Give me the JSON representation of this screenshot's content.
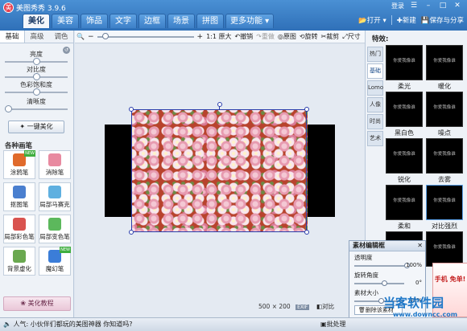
{
  "app": {
    "title": "美图秀秀 3.9.6"
  },
  "top_right": {
    "login": "登录",
    "menu_icon": "menu-icon"
  },
  "tabs": [
    {
      "label": "美化"
    },
    {
      "label": "美容"
    },
    {
      "label": "饰品"
    },
    {
      "label": "文字"
    },
    {
      "label": "边框"
    },
    {
      "label": "场景"
    },
    {
      "label": "拼图"
    },
    {
      "label": "更多功能 ▾"
    }
  ],
  "actions": {
    "open": "打开",
    "new": "新建",
    "save_share": "保存与分享"
  },
  "left_panel": {
    "subtabs": [
      "基础",
      "高级",
      "调色"
    ],
    "sliders": [
      {
        "label": "亮度",
        "value": 0.5
      },
      {
        "label": "对比度",
        "value": 0.5
      },
      {
        "label": "色彩饱和度",
        "value": 0.5
      },
      {
        "label": "清晰度",
        "value": 0.0
      }
    ],
    "one_click": "一键美化",
    "section_title": "各种画笔",
    "brushes": [
      {
        "label": "涂鸦笔",
        "badge": "NEW",
        "color": "#e06a2b"
      },
      {
        "label": "消除笔",
        "badge": "",
        "color": "#e88aa0"
      },
      {
        "label": "抠图笔",
        "badge": "",
        "color": "#4a7fcf"
      },
      {
        "label": "局部马赛克",
        "badge": "",
        "color": "#5fb0e0"
      },
      {
        "label": "局部彩色笔",
        "badge": "",
        "color": "#d9534f"
      },
      {
        "label": "局部变色笔",
        "badge": "",
        "color": "#5cb85c"
      },
      {
        "label": "背景虚化",
        "badge": "",
        "color": "#6aa84f"
      },
      {
        "label": "魔幻笔",
        "badge": "NEW",
        "color": "#3b7dd8"
      }
    ],
    "tutorial": "美化教程"
  },
  "toolbar": {
    "zoom_value": 0.05,
    "one_to_one": "1:1 原大",
    "undo": "撤销",
    "redo": "重做",
    "original": "原图",
    "rotate": "旋转",
    "crop": "裁剪",
    "resize": "尺寸"
  },
  "canvas": {
    "size_text": "500 × 200",
    "fit_badge": "EXIF",
    "compare": "对比"
  },
  "right_panel": {
    "title": "特效:",
    "categories": [
      "热门",
      "基础",
      "Lomo",
      "人像",
      "时尚",
      "艺术"
    ],
    "active_category": "基础",
    "effects": [
      {
        "label": "柔光",
        "thumb": "你爱我像谁"
      },
      {
        "label": "暖化",
        "thumb": "你爱我像谁"
      },
      {
        "label": "黑白色",
        "thumb": "你爱我像谁"
      },
      {
        "label": "噪点",
        "thumb": "你爱我像谁"
      },
      {
        "label": "锐化",
        "thumb": "你爱我像谁"
      },
      {
        "label": "去雾",
        "thumb": "你爱我像谁"
      },
      {
        "label": "柔和",
        "thumb": "你爱我像谁"
      },
      {
        "label": "对比强烈",
        "thumb": "你爱我像谁"
      },
      {
        "label": "",
        "thumb": "你爱我像谁"
      },
      {
        "label": "全彩",
        "thumb": "你爱我像谁"
      }
    ],
    "ad_text": "手机 免单!"
  },
  "material_panel": {
    "title": "素材编辑框",
    "opacity_label": "透明度",
    "opacity_value": "100%",
    "rotation_label": "旋转角度",
    "rotation_value": "0°",
    "size_label": "素材大小",
    "size_value": "48%",
    "delete_btn": "删除该素材"
  },
  "status": {
    "message": "人气: 小伙伴们都玩的美图神器 你知道吗?",
    "batch": "批处理"
  },
  "watermark": {
    "brand": "当客软件园",
    "url": "www.downcc.com"
  }
}
